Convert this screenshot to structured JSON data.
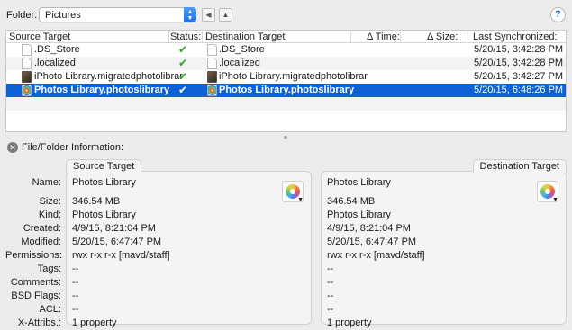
{
  "toolbar": {
    "folder_label": "Folder:",
    "folder_value": "Pictures",
    "help": "?"
  },
  "table": {
    "headers": {
      "source": "Source Target",
      "status": "Status:",
      "destination": "Destination Target",
      "dtime": "Δ Time:",
      "dsize": "Δ Size:",
      "last_sync": "Last Synchronized:"
    },
    "rows": [
      {
        "source": ".DS_Store",
        "status": "✔",
        "destination": ".DS_Store",
        "last_sync": "5/20/15, 3:42:28 PM",
        "icon": "document-icon"
      },
      {
        "source": ".localized",
        "status": "✔",
        "destination": ".localized",
        "last_sync": "5/20/15, 3:42:28 PM",
        "icon": "document-icon"
      },
      {
        "source": "iPhoto Library.migratedphotolibrar",
        "status": "✔",
        "destination": "iPhoto Library.migratedphotolibrar",
        "last_sync": "5/20/15, 3:42:27 PM",
        "icon": "iphoto-library-icon"
      },
      {
        "source": "Photos Library.photoslibrary",
        "status": "✔",
        "destination": "Photos Library.photoslibrary",
        "last_sync": "5/20/15, 6:48:26 PM",
        "icon": "photos-library-icon",
        "selected": true
      }
    ]
  },
  "info": {
    "title": "File/Folder Information:",
    "labels": {
      "name": "Name:",
      "size": "Size:",
      "kind": "Kind:",
      "created": "Created:",
      "modified": "Modified:",
      "permissions": "Permissions:",
      "tags": "Tags:",
      "comments": "Comments:",
      "bsd_flags": "BSD Flags:",
      "acl": "ACL:",
      "xattribs": "X-Attribs.:"
    },
    "source": {
      "tab": "Source Target",
      "name": "Photos Library",
      "size": "346.54 MB",
      "kind": "Photos Library",
      "created": "4/9/15, 8:21:04 PM",
      "modified": "5/20/15, 6:47:47 PM",
      "permissions": "rwx r-x r-x   [mavd/staff]",
      "tags": "--",
      "comments": "--",
      "bsd_flags": "--",
      "acl": "--",
      "xattribs": "1 property"
    },
    "destination": {
      "tab": "Destination Target",
      "name": "Photos Library",
      "size": "346.54 MB",
      "kind": "Photos Library",
      "created": "4/9/15, 8:21:04 PM",
      "modified": "5/20/15, 6:47:47 PM",
      "permissions": "rwx r-x r-x   [mavd/staff]",
      "tags": "--",
      "comments": "--",
      "bsd_flags": "--",
      "acl": "--",
      "xattribs": "1 property"
    }
  }
}
